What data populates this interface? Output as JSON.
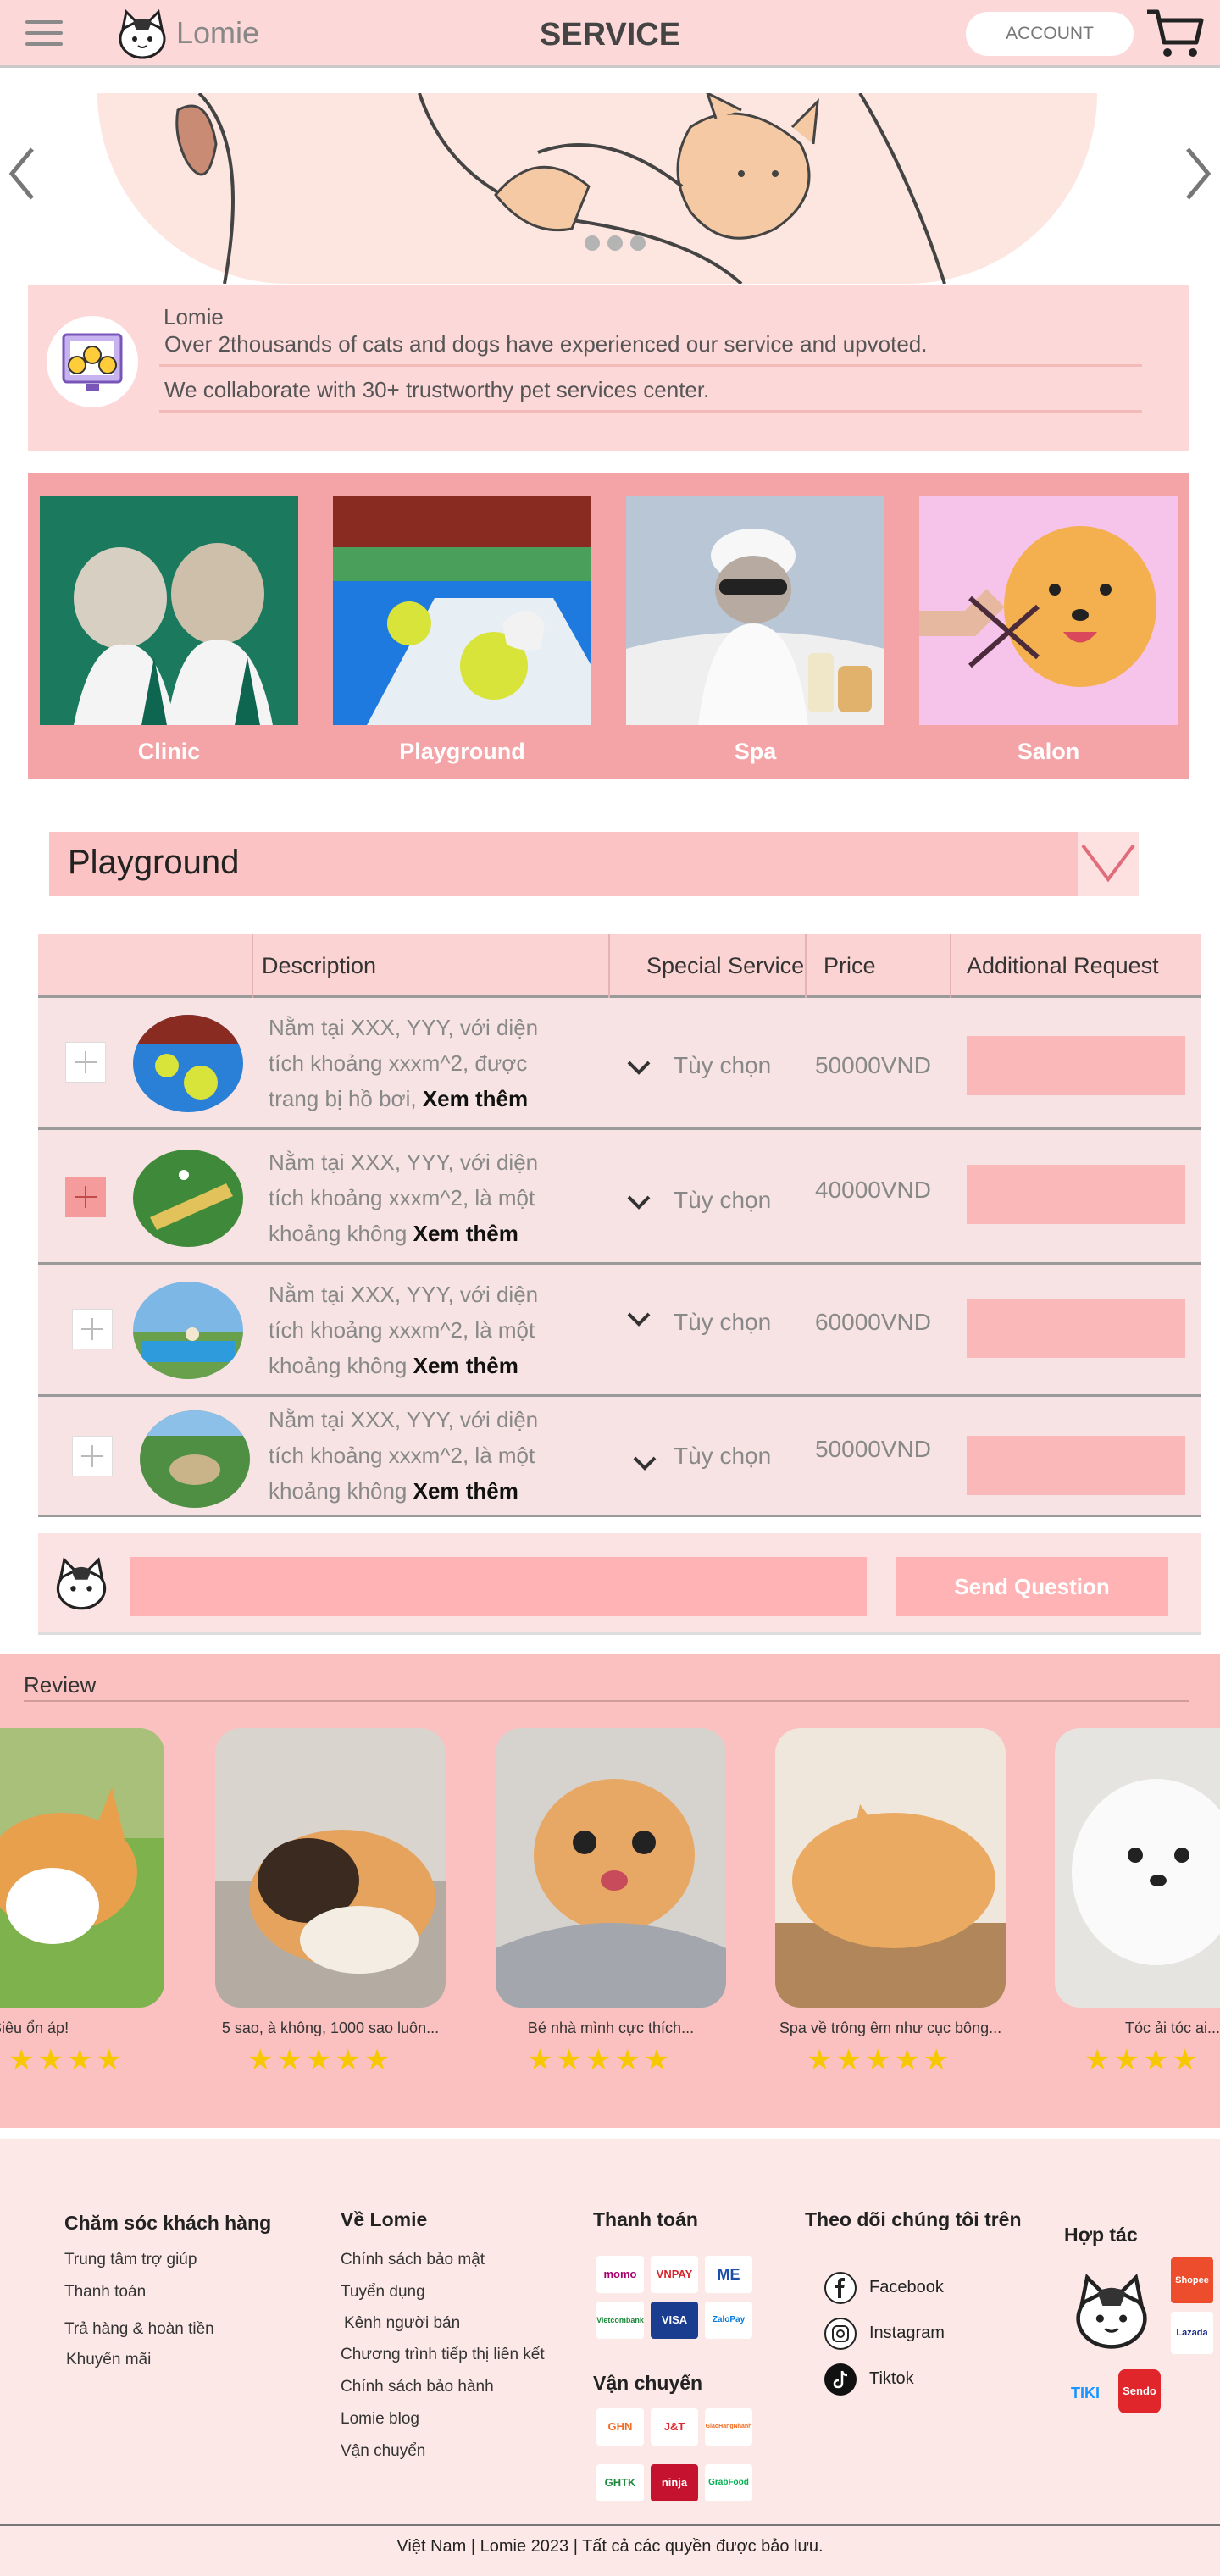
{
  "header": {
    "brand": "Lomie",
    "title": "SERVICE",
    "account_label": "ACCOUNT"
  },
  "stats": {
    "brand": "Lomie",
    "line1": "Over 2thousands of cats and dogs have experienced our service and upvoted.",
    "line2": "We collaborate with 30+ trustworthy pet services center."
  },
  "services": [
    {
      "label": "Clinic"
    },
    {
      "label": "Playground"
    },
    {
      "label": "Spa"
    },
    {
      "label": "Salon"
    }
  ],
  "selector": {
    "value": "Playground"
  },
  "table": {
    "headers": [
      "Description",
      "Special Service",
      "Price",
      "Additional Request"
    ],
    "rows": [
      {
        "desc": "Nằm tại XXX, YYY, với diện tích khoảng xxxm^2, được trang bị hồ bơi,",
        "more": "Xem thêm",
        "option": "Tùy chọn",
        "price": "50000VND",
        "selected": false
      },
      {
        "desc": "Nằm tại XXX, YYY, với diện tích khoảng xxxm^2, là một khoảng không",
        "more": "Xem thêm",
        "option": "Tùy chọn",
        "price": "40000VND",
        "selected": true
      },
      {
        "desc": "Nằm tại XXX, YYY, với diện tích khoảng xxxm^2, là một khoảng không",
        "more": "Xem thêm",
        "option": "Tùy chọn",
        "price": "60000VND",
        "selected": false
      },
      {
        "desc": "Nằm tại XXX, YYY, với diện tích khoảng xxxm^2, là một khoảng không",
        "more": "Xem thêm",
        "option": "Tùy chọn",
        "price": "50000VND",
        "selected": false
      }
    ]
  },
  "question": {
    "send_label": "Send Question"
  },
  "review": {
    "title": "Review",
    "items": [
      {
        "caption": "Siêu ổn áp!",
        "stars": 4
      },
      {
        "caption": "5 sao, à không, 1000 sao luôn...",
        "stars": 5
      },
      {
        "caption": "Bé nhà mình cực thích...",
        "stars": 5
      },
      {
        "caption": "Spa về trông êm như cục bông...",
        "stars": 5
      },
      {
        "caption": "Tóc ải tóc ai...",
        "stars": 4
      }
    ]
  },
  "footer": {
    "care": {
      "title": "Chăm sóc khách hàng",
      "links": [
        "Trung tâm trợ giúp",
        "Thanh toán",
        "Trả hàng & hoàn tiền",
        "Khuyến mãi"
      ]
    },
    "about": {
      "title": "Về Lomie",
      "links": [
        "Chính sách bảo mật",
        "Tuyển dụng",
        "Kênh người bán",
        "Chương trình tiếp thị liên kết",
        "Chính sách bảo hành",
        "Lomie blog",
        "Vận chuyển"
      ]
    },
    "payment": {
      "title": "Thanh toán",
      "methods": [
        "momo",
        "VNPAY",
        "ME",
        "Vietcombank",
        "VISA",
        "ZaloPay"
      ]
    },
    "shipping": {
      "title": "Vận chuyển",
      "methods": [
        "GHN",
        "J&T",
        "GiaoHangNhanh",
        "GHTK",
        "ninja",
        "GrabFood"
      ]
    },
    "follow": {
      "title": "Theo dõi chúng tôi trên",
      "links": [
        "Facebook",
        "Instagram",
        "Tiktok"
      ]
    },
    "partner": {
      "title": "Hợp tác",
      "brands": [
        "Shopee",
        "Lazada",
        "TIKI",
        "Sendo"
      ]
    },
    "copyright": "Việt Nam | Lomie 2023 | Tất cả các quyền được bảo lưu."
  }
}
